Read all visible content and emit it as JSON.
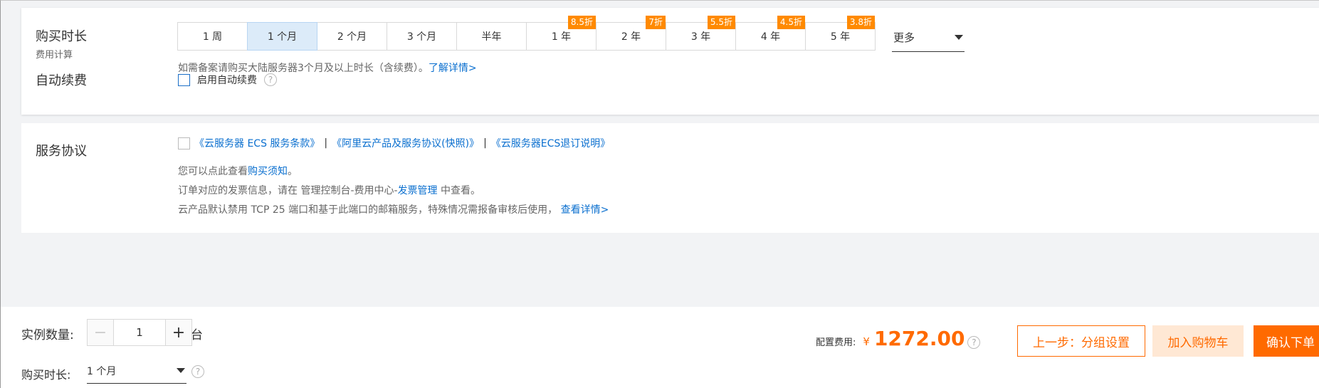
{
  "duration": {
    "label": "购买时长",
    "sub_label": "费用计算",
    "periods": [
      {
        "label": "1 周",
        "badge": ""
      },
      {
        "label": "1 个月",
        "badge": ""
      },
      {
        "label": "2 个月",
        "badge": ""
      },
      {
        "label": "3 个月",
        "badge": ""
      },
      {
        "label": "半年",
        "badge": ""
      },
      {
        "label": "1 年",
        "badge": "8.5折"
      },
      {
        "label": "2 年",
        "badge": "7折"
      },
      {
        "label": "3 年",
        "badge": "5.5折"
      },
      {
        "label": "4 年",
        "badge": "4.5折"
      },
      {
        "label": "5 年",
        "badge": "3.8折"
      }
    ],
    "selected": "1 个月",
    "more_label": "更多",
    "hint": "如需备案请购买大陆服务器3个月及以上时长（含续费）。",
    "hint_link": "了解详情>"
  },
  "auto_renew": {
    "label": "自动续费",
    "checkbox_label": "启用自动续费",
    "help": "?"
  },
  "agreement": {
    "label": "服务协议",
    "links": [
      "《云服务器 ECS 服务条款》",
      "《阿里云产品及服务协议(快照)》",
      "《云服务器ECS退订说明》"
    ],
    "separator": "|",
    "line1_prefix": "您可以点此查看",
    "line1_link": "购买须知",
    "line1_suffix": "。",
    "line2_prefix": "订单对应的发票信息，请在 管理控制台-费用中心-",
    "line2_link": "发票管理",
    "line2_suffix": " 中查看。",
    "line3_prefix": "云产品默认禁用 TCP 25 端口和基于此端口的邮箱服务，特殊情况需报备审核后使用，",
    "line3_link": "查看详情>"
  },
  "bottom": {
    "quantity_label": "实例数量:",
    "quantity_value": "1",
    "minus": "−",
    "plus": "+",
    "unit": "台",
    "duration_label": "购买时长:",
    "duration_value": "1 个月",
    "fee_label": "配置费用:",
    "currency": "¥",
    "fee_value": "1272.00",
    "help": "?",
    "prev_button": "上一步：分组设置",
    "cart_button": "加入购物车",
    "confirm_button": "确认下单"
  },
  "colors": {
    "accent": "#ff6a00",
    "link": "#0a6fcf",
    "selected_bg": "#dcebf9",
    "badge": "#ff8a00"
  }
}
